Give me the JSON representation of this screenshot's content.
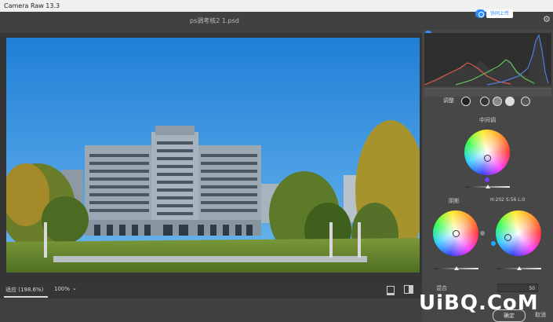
{
  "app": {
    "title": "Camera Raw 13.3"
  },
  "header": {
    "filename": "ps调考核2 1.psd",
    "cloud_button": "协同上传",
    "settings_icon": "gear-icon"
  },
  "viewer": {
    "zoom_mode": "适应 (198.6%)",
    "zoom_percent": "100%",
    "zoom_chevron": "chevron-down-icon"
  },
  "panel": {
    "adjust_label": "调整",
    "midtones_label": "中间调",
    "shadows_label": "阴影",
    "shadows_readout": "H:202  S:56   L:0",
    "blend_label": "混合",
    "blend_value": "50"
  },
  "footer": {
    "ok_label": "确定",
    "cancel_label": "取消"
  },
  "watermark": {
    "text": "UiBQ.CoM"
  },
  "colors": {
    "accent": "#2d8cff",
    "panel_bg": "#474747",
    "sky": "#2f8fe0"
  }
}
